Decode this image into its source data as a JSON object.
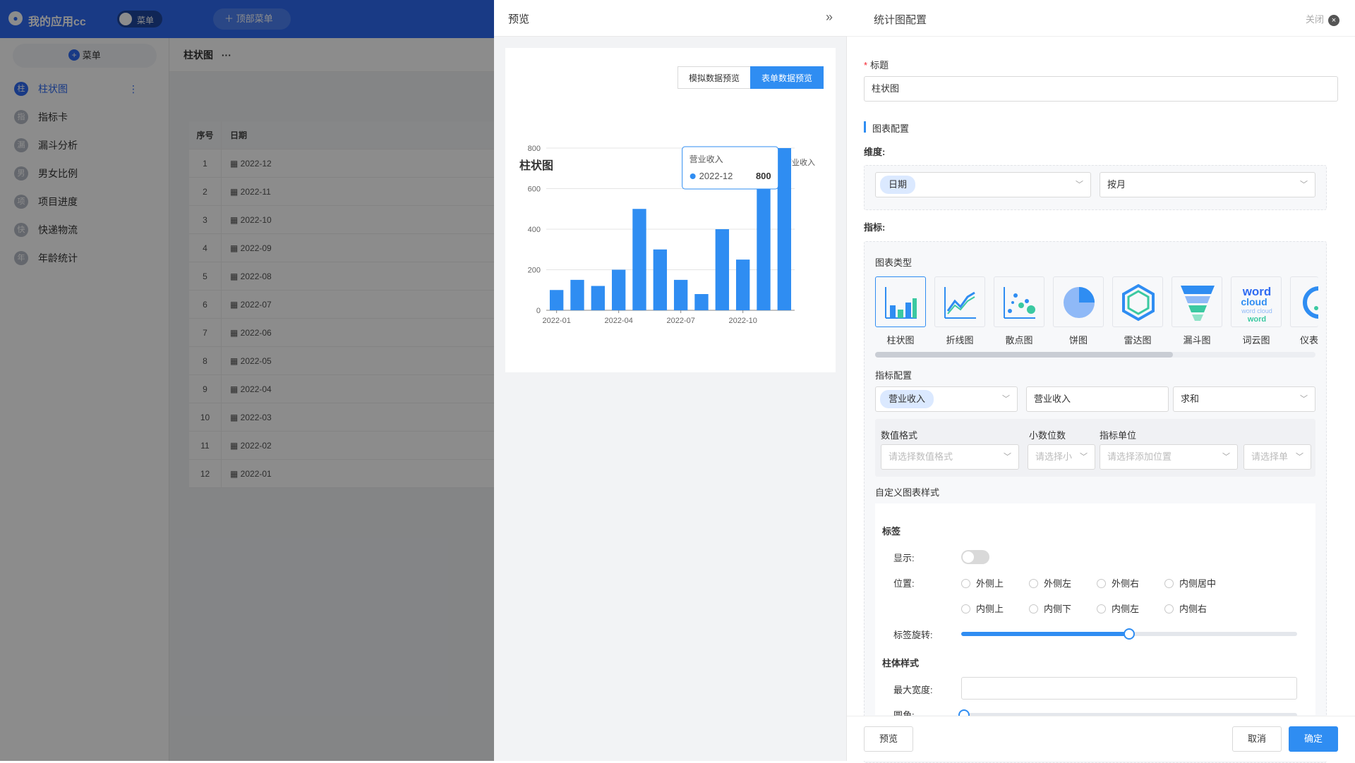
{
  "app": {
    "name": "我的应用cc",
    "toggle_label": "菜单",
    "top_menu_label": "顶部菜单",
    "add_menu_label": "菜单",
    "breadcrumb": "柱状图",
    "breadcrumb_more": "···",
    "nav": [
      {
        "icon_char": "柱",
        "label": "柱状图",
        "active": true
      },
      {
        "icon_char": "指",
        "label": "指标卡"
      },
      {
        "icon_char": "漏",
        "label": "漏斗分析"
      },
      {
        "icon_char": "男",
        "label": "男女比例"
      },
      {
        "icon_char": "项",
        "label": "项目进度"
      },
      {
        "icon_char": "快",
        "label": "快递物流"
      },
      {
        "icon_char": "年",
        "label": "年龄统计"
      }
    ],
    "table": {
      "headers": [
        "序号",
        "日期"
      ],
      "rows": [
        [
          "1",
          "2022-12"
        ],
        [
          "2",
          "2022-11"
        ],
        [
          "3",
          "2022-10"
        ],
        [
          "4",
          "2022-09"
        ],
        [
          "5",
          "2022-08"
        ],
        [
          "6",
          "2022-07"
        ],
        [
          "7",
          "2022-06"
        ],
        [
          "8",
          "2022-05"
        ],
        [
          "9",
          "2022-04"
        ],
        [
          "10",
          "2022-03"
        ],
        [
          "11",
          "2022-02"
        ],
        [
          "12",
          "2022-01"
        ]
      ]
    }
  },
  "preview": {
    "title": "预览",
    "collapse_icon": "double-chevron-right-icon",
    "tabs": [
      "模拟数据预览",
      "表单数据预览"
    ],
    "active_tab": 1
  },
  "chart_data": {
    "type": "bar",
    "title": "柱状图",
    "legend": [
      "营业收入"
    ],
    "legend_position": "top-right",
    "categories": [
      "2022-01",
      "2022-02",
      "2022-03",
      "2022-04",
      "2022-05",
      "2022-06",
      "2022-07",
      "2022-08",
      "2022-09",
      "2022-10",
      "2022-11",
      "2022-12"
    ],
    "series": [
      {
        "name": "营业收入",
        "values": [
          100,
          150,
          120,
          200,
          500,
          300,
          150,
          80,
          400,
          250,
          700,
          800
        ]
      }
    ],
    "x_tick_labels": [
      "2022-01",
      "2022-04",
      "2022-07",
      "2022-10"
    ],
    "y_ticks": [
      0,
      200,
      400,
      600,
      800
    ],
    "ylim": [
      0,
      800
    ],
    "grid": true,
    "color": "#2f8df2",
    "tooltip": {
      "series": "营业收入",
      "category": "2022-12",
      "value": "800"
    }
  },
  "config": {
    "title": "统计图配置",
    "close_label": "关闭",
    "title_field_label": "标题",
    "title_value": "柱状图",
    "chart_section": "图表配置",
    "dimension_label": "维度:",
    "dimension_tag": "日期",
    "dimension_mode": "按月",
    "metric_label": "指标:",
    "chart_type_label": "图表类型",
    "chart_types": [
      "柱状图",
      "折线图",
      "散点图",
      "饼图",
      "雷达图",
      "漏斗图",
      "词云图",
      "仪表"
    ],
    "metric_config_label": "指标配置",
    "metric_tag": "营业收入",
    "metric_alias": "营业收入",
    "metric_agg": "求和",
    "number_format_label": "数值格式",
    "number_format_ph": "请选择数值格式",
    "decimal_label": "小数位数",
    "decimal_ph": "请选择小",
    "unit_label": "指标单位",
    "unit_pos_ph": "请选择添加位置",
    "unit_ph": "请选择单",
    "custom_style_label": "自定义图表样式",
    "label_section": "标签",
    "show_label": "显示:",
    "position_label": "位置:",
    "positions": [
      "外侧上",
      "外侧左",
      "外侧右",
      "内侧居中",
      "内侧上",
      "内侧下",
      "内侧左",
      "内侧右"
    ],
    "rotate_label": "标签旋转:",
    "rotate_value": 0.5,
    "bar_style_section": "柱体样式",
    "max_width_label": "最大宽度:",
    "radius_label": "圆角:",
    "radius_value": 0,
    "wordcloud_text": [
      "word",
      "cloud",
      "word cloud",
      "word"
    ],
    "buttons": {
      "preview": "预览",
      "cancel": "取消",
      "ok": "确定"
    }
  }
}
